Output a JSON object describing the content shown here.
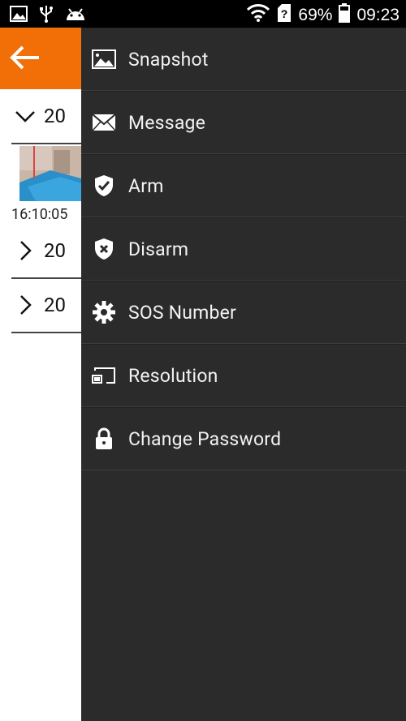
{
  "status_bar": {
    "battery_percent": "69%",
    "time": "09:23"
  },
  "background_page": {
    "groups": [
      {
        "year": "20",
        "expanded": true
      },
      {
        "year": "20",
        "expanded": false
      },
      {
        "year": "20",
        "expanded": false
      }
    ],
    "thumbnail_time": "16:10:05"
  },
  "drawer": {
    "items": [
      {
        "label": "Snapshot",
        "icon": "image-icon"
      },
      {
        "label": "Message",
        "icon": "envelope-icon"
      },
      {
        "label": "Arm",
        "icon": "shield-check-icon"
      },
      {
        "label": "Disarm",
        "icon": "shield-x-icon"
      },
      {
        "label": "SOS Number",
        "icon": "gear-icon"
      },
      {
        "label": "Resolution",
        "icon": "cast-screen-icon"
      },
      {
        "label": "Change Password",
        "icon": "lock-icon"
      }
    ]
  },
  "colors": {
    "accent": "#f26f08",
    "drawer_bg": "#2b2b2b",
    "status_bar": "#000000"
  }
}
